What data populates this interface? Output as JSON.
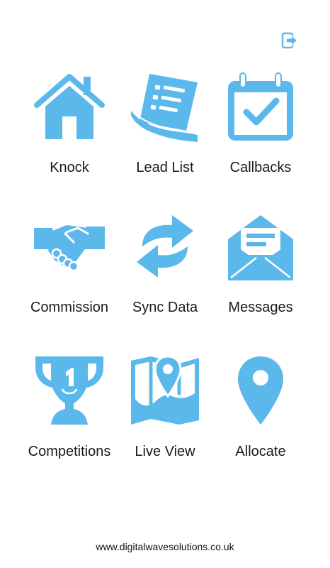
{
  "colors": {
    "accent": "#5bb8eb",
    "text": "#1a1a1a",
    "background": "#ffffff"
  },
  "header": {
    "logout_icon": "logout-icon"
  },
  "menu": {
    "items": [
      {
        "label": "Knock",
        "icon": "house-icon"
      },
      {
        "label": "Lead List",
        "icon": "document-list-icon"
      },
      {
        "label": "Callbacks",
        "icon": "calendar-check-icon"
      },
      {
        "label": "Commission",
        "icon": "handshake-icon"
      },
      {
        "label": "Sync Data",
        "icon": "sync-arrows-icon"
      },
      {
        "label": "Messages",
        "icon": "open-envelope-icon"
      },
      {
        "label": "Competitions",
        "icon": "trophy-icon"
      },
      {
        "label": "Live View",
        "icon": "map-pin-icon"
      },
      {
        "label": "Allocate",
        "icon": "location-pin-icon"
      }
    ]
  },
  "footer": {
    "text": "www.digitalwavesolutions.co.uk"
  }
}
